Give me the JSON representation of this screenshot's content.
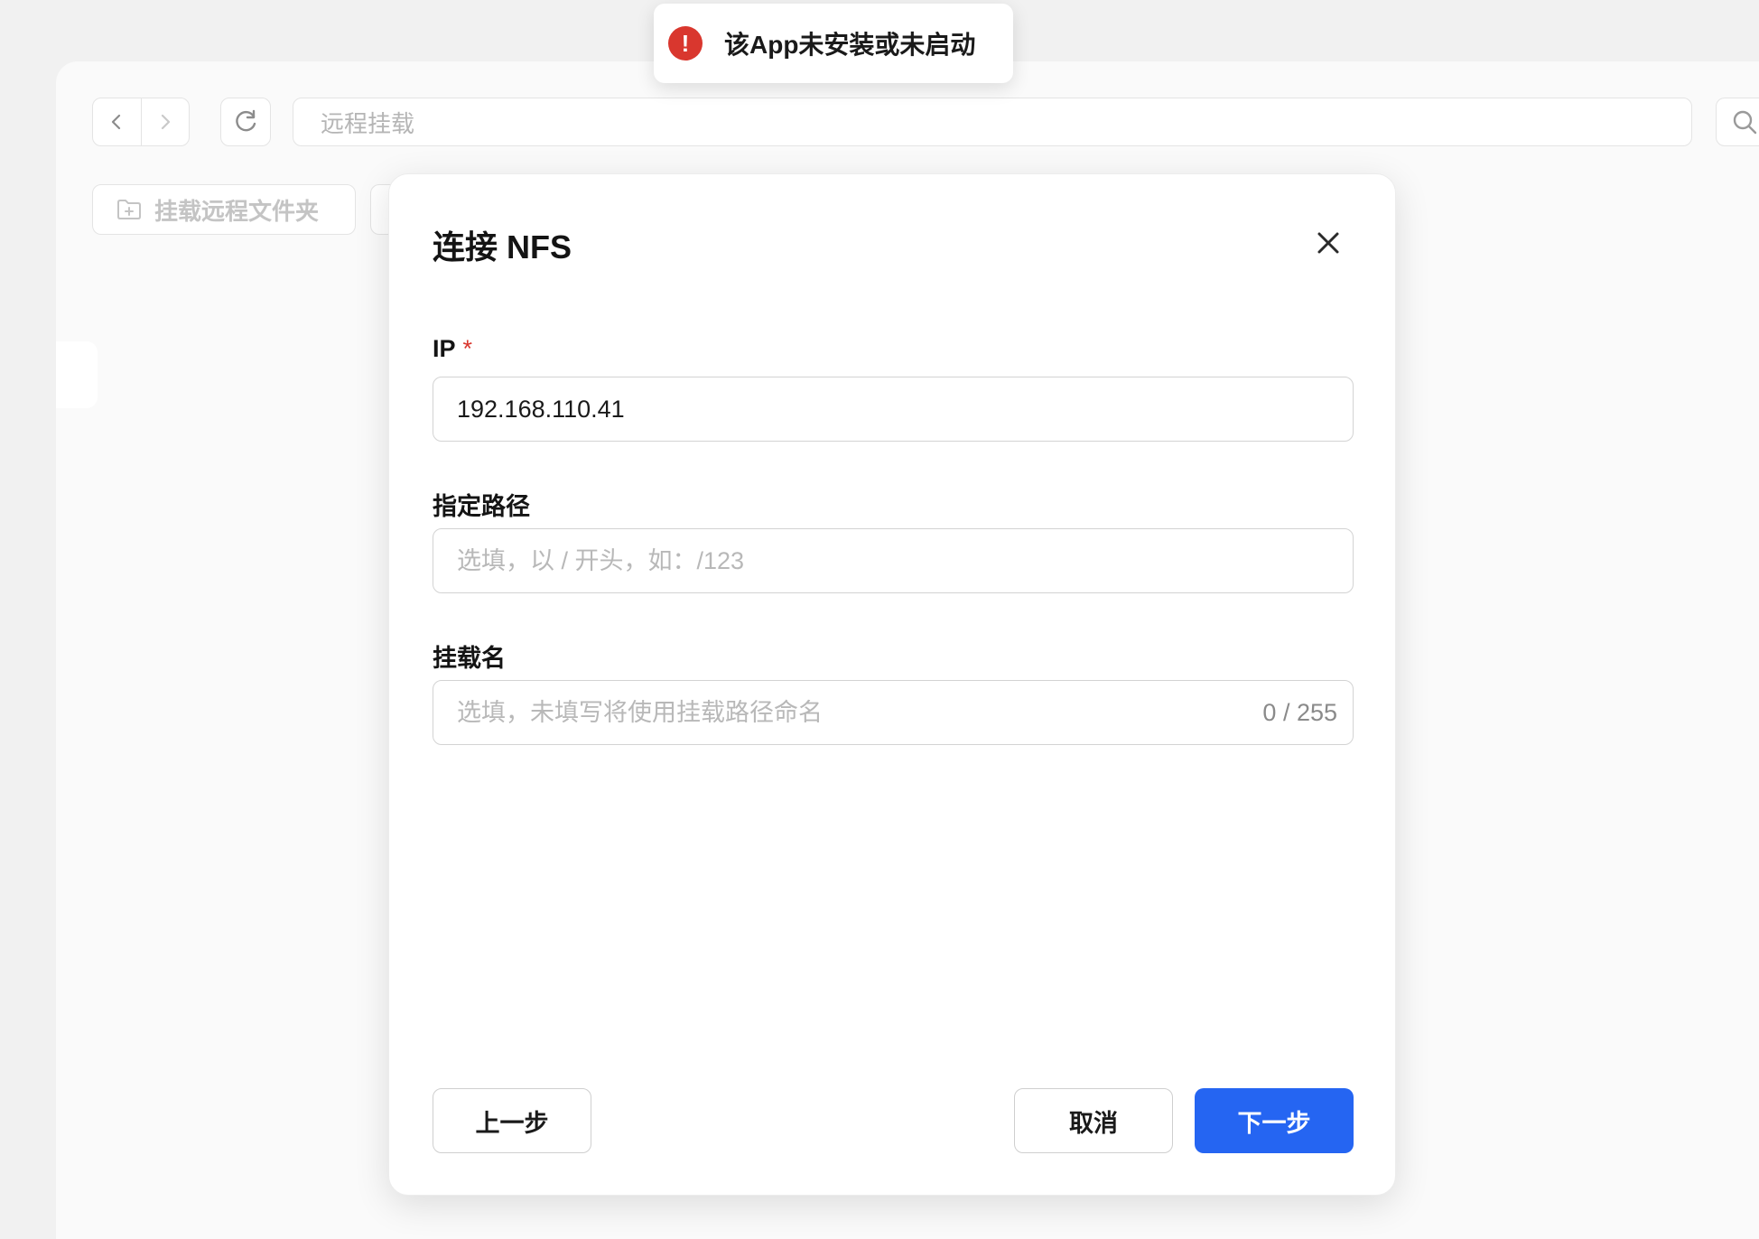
{
  "toast": {
    "message": "该App未安装或未启动",
    "icon": "error-icon",
    "color": "#d9372e"
  },
  "background": {
    "address_bar_text": "远程挂载",
    "toolbar_button_label": "挂载远程文件夹"
  },
  "modal": {
    "title": "连接 NFS",
    "fields": {
      "ip": {
        "label": "IP",
        "required_mark": "*",
        "value": "192.168.110.41"
      },
      "path": {
        "label": "指定路径",
        "placeholder": "选填，以 / 开头，如：/123"
      },
      "mount_name": {
        "label": "挂载名",
        "placeholder": "选填，未填写将使用挂载路径命名",
        "counter": "0 / 255"
      }
    },
    "buttons": {
      "prev": "上一步",
      "cancel": "取消",
      "next": "下一步"
    },
    "primary_color": "#2565f2"
  }
}
